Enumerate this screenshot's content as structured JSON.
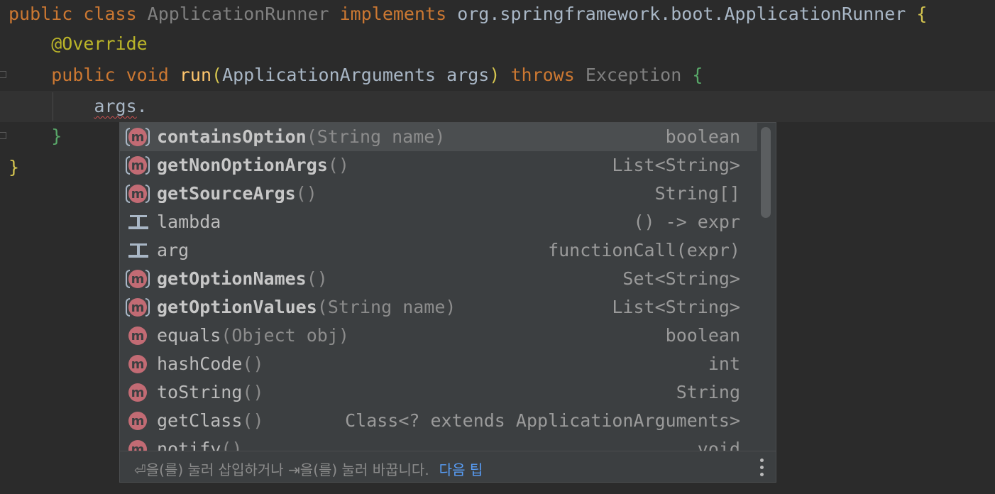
{
  "editor": {
    "lines": [
      [
        {
          "text": "public class ",
          "cls": "kw"
        },
        {
          "text": "ApplicationRunner ",
          "cls": "dim"
        },
        {
          "text": "implements ",
          "cls": "kw"
        },
        {
          "text": "org.springframework.boot.ApplicationRunner ",
          "cls": "plain"
        },
        {
          "text": "{",
          "cls": "brace-y"
        }
      ],
      [
        {
          "text": "    ",
          "cls": "plain"
        },
        {
          "text": "@Override",
          "cls": "ann"
        }
      ],
      [
        {
          "text": "    ",
          "cls": "plain"
        },
        {
          "text": "public void ",
          "cls": "kw"
        },
        {
          "text": "run",
          "cls": "fn"
        },
        {
          "text": "(",
          "cls": "brace-y"
        },
        {
          "text": "ApplicationArguments args",
          "cls": "plain"
        },
        {
          "text": ") ",
          "cls": "brace-y"
        },
        {
          "text": "throws ",
          "cls": "kw"
        },
        {
          "text": "Exception ",
          "cls": "dim"
        },
        {
          "text": "{",
          "cls": "brace-g"
        }
      ],
      [
        {
          "text": "        ",
          "cls": "plain"
        },
        {
          "text": "args",
          "cls": "plain squiggle"
        },
        {
          "text": ".",
          "cls": "plain"
        }
      ],
      [
        {
          "text": "    ",
          "cls": "plain"
        },
        {
          "text": "}",
          "cls": "brace-g"
        }
      ],
      [
        {
          "text": "}",
          "cls": "brace-y"
        }
      ]
    ]
  },
  "completion": {
    "items": [
      {
        "icon": "m-wrapped",
        "name": "containsOption",
        "params": "(String name)",
        "type": "boolean",
        "bold": true,
        "selected": true
      },
      {
        "icon": "m-wrapped",
        "name": "getNonOptionArgs",
        "params": "()",
        "type": "List<String>",
        "bold": true
      },
      {
        "icon": "m-wrapped",
        "name": "getSourceArgs",
        "params": "()",
        "type": "String[]",
        "bold": true
      },
      {
        "icon": "template",
        "name": "lambda",
        "params": "",
        "type": "() -> expr",
        "bold": false
      },
      {
        "icon": "template",
        "name": "arg",
        "params": "",
        "type": "functionCall(expr)",
        "bold": false
      },
      {
        "icon": "m-wrapped",
        "name": "getOptionNames",
        "params": "()",
        "type": "Set<String>",
        "bold": true
      },
      {
        "icon": "m-wrapped",
        "name": "getOptionValues",
        "params": "(String name)",
        "type": "List<String>",
        "bold": true
      },
      {
        "icon": "m",
        "name": "equals",
        "params": "(Object obj)",
        "type": "boolean",
        "bold": false
      },
      {
        "icon": "m",
        "name": "hashCode",
        "params": "()",
        "type": "int",
        "bold": false
      },
      {
        "icon": "m",
        "name": "toString",
        "params": "()",
        "type": "String",
        "bold": false
      },
      {
        "icon": "m",
        "name": "getClass",
        "params": "()",
        "type": "Class<? extends ApplicationArguments>",
        "bold": false
      },
      {
        "icon": "m",
        "name": "notify",
        "params": "()",
        "type": "void",
        "bold": false
      }
    ],
    "footer": {
      "hint": "⏎을(를) 눌러 삽입하거나 ⇥을(를) 눌러 바꿉니다.",
      "link": "다음 팁"
    },
    "icon_letter": "m"
  }
}
